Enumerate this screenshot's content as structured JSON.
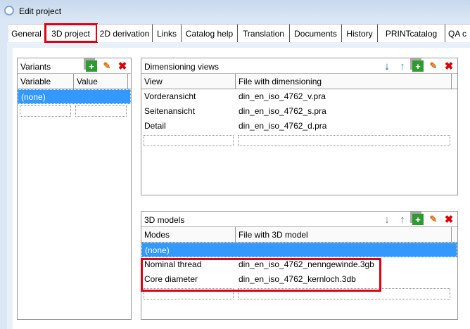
{
  "window": {
    "title": "Edit project"
  },
  "tabs": [
    "General",
    "3D project",
    "2D derivation",
    "Links",
    "Catalog help",
    "Translation",
    "Documents",
    "History",
    "PRINTcatalog",
    "QA c"
  ],
  "variants": {
    "title": "Variants",
    "columns": [
      "Variable",
      "Value"
    ],
    "rows": [
      "(none)"
    ]
  },
  "dimensioning_views": {
    "title": "Dimensioning views",
    "columns": [
      "View",
      "File with dimensioning"
    ],
    "rows": [
      [
        "Vorderansicht",
        "din_en_iso_4762_v.pra"
      ],
      [
        "Seitenansicht",
        "din_en_iso_4762_s.pra"
      ],
      [
        "Detail",
        "din_en_iso_4762_d.pra"
      ]
    ]
  },
  "models_3d": {
    "title": "3D models",
    "columns": [
      "Modes",
      "File with 3D model"
    ],
    "rows": [
      [
        "(none)",
        ""
      ],
      [
        "Nominal thread",
        "din_en_iso_4762_nenngewinde.3gb"
      ],
      [
        "Core diameter",
        "din_en_iso_4762_kernloch.3db"
      ]
    ]
  },
  "icons": {
    "add": "add-icon",
    "edit": "edit-icon",
    "delete": "delete-icon",
    "down": "arrow-down-icon",
    "up": "arrow-up-icon"
  },
  "colors": {
    "highlight": "#e00010",
    "selection": "#3399ff"
  }
}
